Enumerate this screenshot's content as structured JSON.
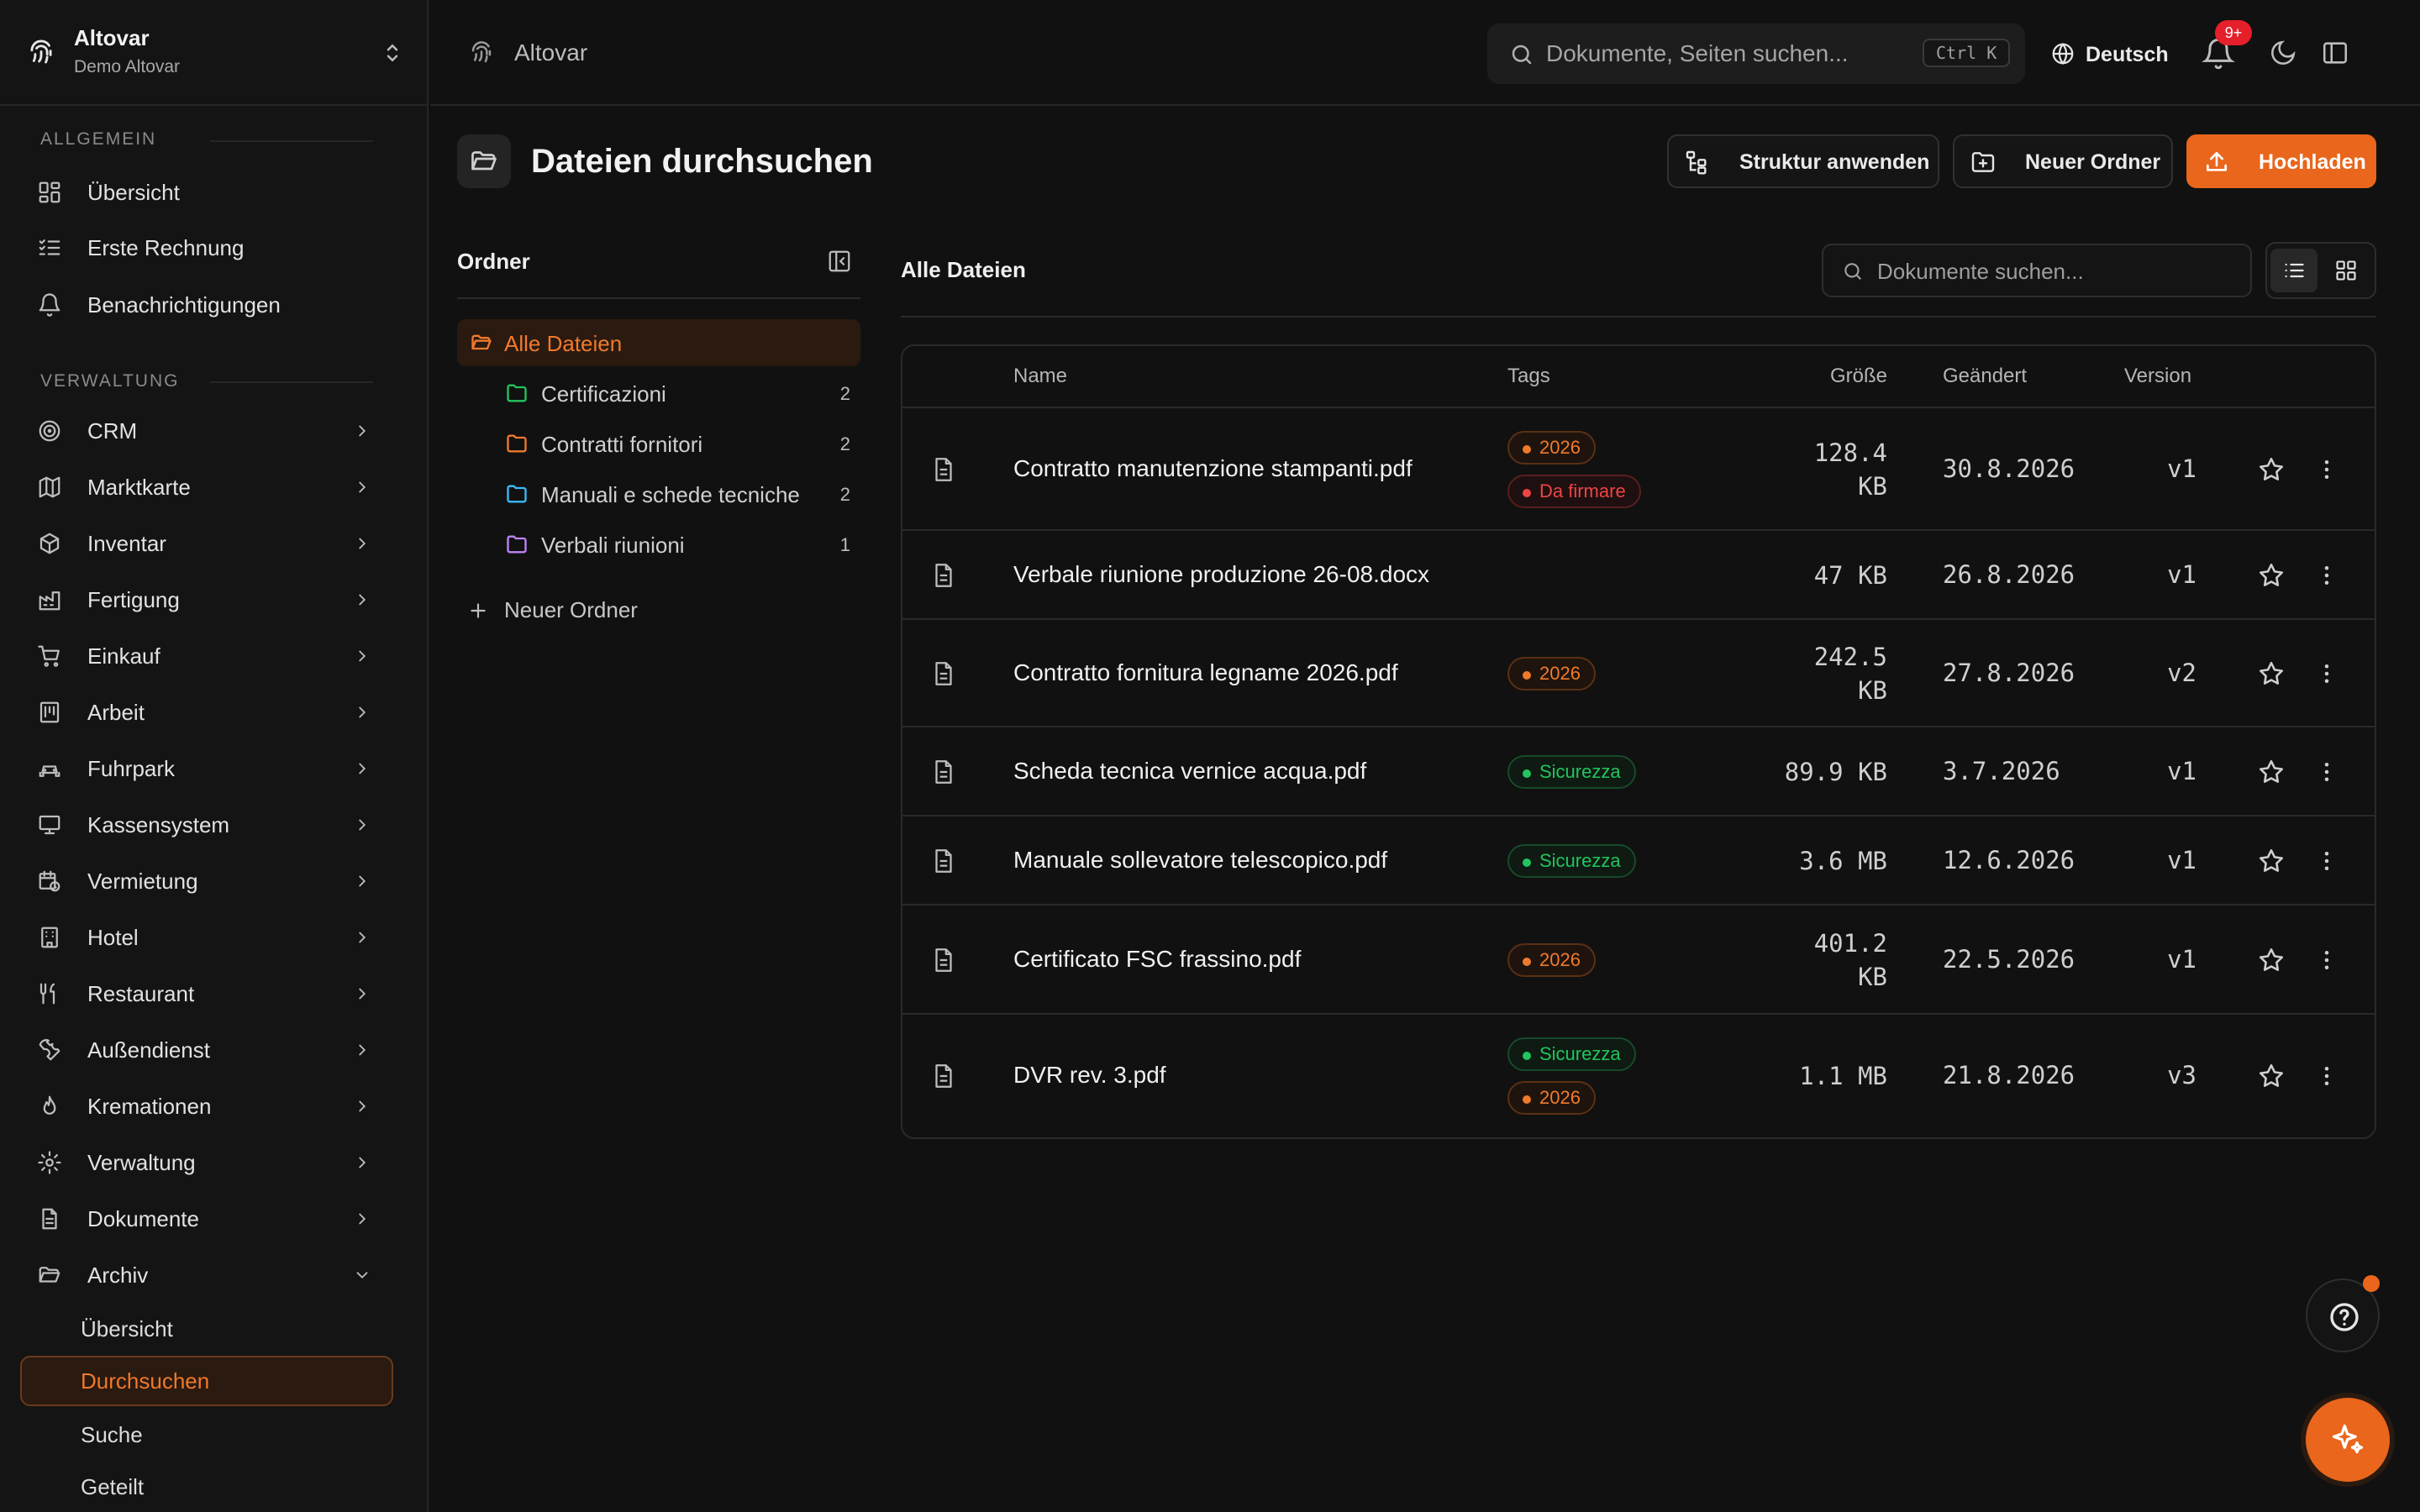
{
  "brand": {
    "name": "Altovar",
    "org": "Demo Altovar"
  },
  "sidebar": {
    "section_general": "ALLGEMEIN",
    "general_items": [
      {
        "label": "Übersicht",
        "icon": "dashboard-icon"
      },
      {
        "label": "Erste Rechnung",
        "icon": "checklist-icon"
      },
      {
        "label": "Benachrichtigungen",
        "icon": "bell-icon"
      }
    ],
    "section_admin": "VERWALTUNG",
    "admin_items": [
      {
        "label": "CRM",
        "icon": "target-icon"
      },
      {
        "label": "Marktkarte",
        "icon": "map-icon"
      },
      {
        "label": "Inventar",
        "icon": "box-icon"
      },
      {
        "label": "Fertigung",
        "icon": "factory-icon"
      },
      {
        "label": "Einkauf",
        "icon": "cart-icon"
      },
      {
        "label": "Arbeit",
        "icon": "work-icon"
      },
      {
        "label": "Fuhrpark",
        "icon": "car-icon"
      },
      {
        "label": "Kassensystem",
        "icon": "monitor-icon"
      },
      {
        "label": "Vermietung",
        "icon": "calendar-clock-icon"
      },
      {
        "label": "Hotel",
        "icon": "building-icon"
      },
      {
        "label": "Restaurant",
        "icon": "utensils-icon"
      },
      {
        "label": "Außendienst",
        "icon": "wrench-icon"
      },
      {
        "label": "Kremationen",
        "icon": "flame-icon"
      },
      {
        "label": "Verwaltung",
        "icon": "gear-icon"
      },
      {
        "label": "Dokumente",
        "icon": "document-icon"
      },
      {
        "label": "Archiv",
        "icon": "folder-open-icon"
      }
    ],
    "archive_sub": [
      "Übersicht",
      "Durchsuchen",
      "Suche",
      "Geteilt"
    ]
  },
  "topbar": {
    "breadcrumb": "Altovar",
    "search_placeholder": "Dokumente, Seiten suchen...",
    "shortcut": "Ctrl K",
    "language": "Deutsch",
    "notif_badge": "9+"
  },
  "page": {
    "title": "Dateien durchsuchen",
    "btn_structure": "Struktur anwenden",
    "btn_new_folder": "Neuer Ordner",
    "btn_upload": "Hochladen"
  },
  "folders": {
    "title": "Ordner",
    "all": "Alle Dateien",
    "items": [
      {
        "label": "Certificazioni",
        "count": "2",
        "color": "#22c55e"
      },
      {
        "label": "Contratti fornitori",
        "count": "2",
        "color": "#f07a2c"
      },
      {
        "label": "Manuali e schede tecniche",
        "count": "2",
        "color": "#38bdf8"
      },
      {
        "label": "Verbali riunioni",
        "count": "1",
        "color": "#c084fc"
      }
    ],
    "new_folder": "Neuer Ordner"
  },
  "files": {
    "title": "Alle Dateien",
    "search_placeholder": "Dokumente suchen...",
    "columns": {
      "name": "Name",
      "tags": "Tags",
      "size": "Größe",
      "modified": "Geändert",
      "version": "Version"
    },
    "rows": [
      {
        "name": "Contratto manutenzione stampanti.pdf",
        "tags": [
          {
            "t": "2026",
            "c": "orange"
          },
          {
            "t": "Da firmare",
            "c": "red"
          }
        ],
        "size": [
          "128.4",
          "KB"
        ],
        "modified": "30.8.2026",
        "version": "v1"
      },
      {
        "name": "Verbale riunione produzione 26-08.docx",
        "tags": [],
        "size": [
          "47 KB"
        ],
        "modified": "26.8.2026",
        "version": "v1"
      },
      {
        "name": "Contratto fornitura legname 2026.pdf",
        "tags": [
          {
            "t": "2026",
            "c": "orange"
          }
        ],
        "size": [
          "242.5",
          "KB"
        ],
        "modified": "27.8.2026",
        "version": "v2"
      },
      {
        "name": "Scheda tecnica vernice acqua.pdf",
        "tags": [
          {
            "t": "Sicurezza",
            "c": "green"
          }
        ],
        "size": [
          "89.9 KB"
        ],
        "modified": "3.7.2026",
        "version": "v1"
      },
      {
        "name": "Manuale sollevatore telescopico.pdf",
        "tags": [
          {
            "t": "Sicurezza",
            "c": "green"
          }
        ],
        "size": [
          "3.6 MB"
        ],
        "modified": "12.6.2026",
        "version": "v1"
      },
      {
        "name": "Certificato FSC frassino.pdf",
        "tags": [
          {
            "t": "2026",
            "c": "orange"
          }
        ],
        "size": [
          "401.2",
          "KB"
        ],
        "modified": "22.5.2026",
        "version": "v1"
      },
      {
        "name": "DVR rev. 3.pdf",
        "tags": [
          {
            "t": "Sicurezza",
            "c": "green"
          },
          {
            "t": "2026",
            "c": "orange"
          }
        ],
        "size": [
          "1.1 MB"
        ],
        "modified": "21.8.2026",
        "version": "v3"
      }
    ]
  },
  "colors": {
    "accent": "#e9661c",
    "background": "#111111"
  }
}
